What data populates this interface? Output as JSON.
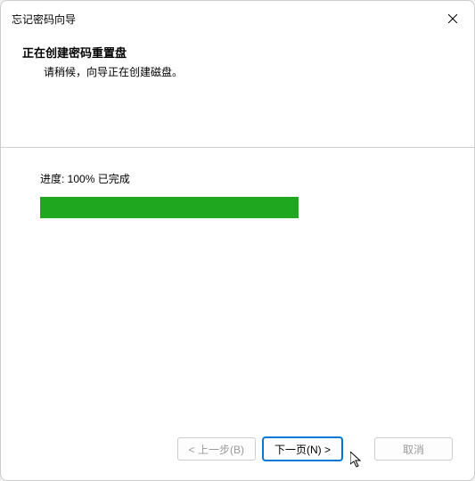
{
  "titlebar": {
    "title": "忘记密码向导"
  },
  "header": {
    "heading": "正在创建密码重置盘",
    "subheading": "请稍候，向导正在创建磁盘。"
  },
  "progress": {
    "label": "进度: 100% 已完成",
    "percent": 100
  },
  "footer": {
    "back_label": "< 上一步(B)",
    "next_label": "下一页(N) >",
    "cancel_label": "取消"
  }
}
